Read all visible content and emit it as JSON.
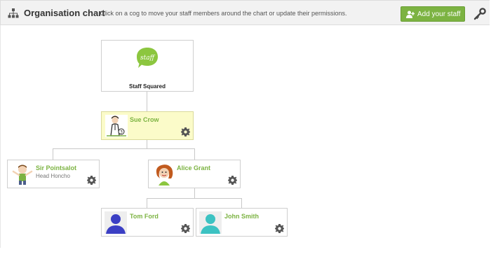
{
  "header": {
    "title": "Organisation chart",
    "subtitle": "- Click on a cog to move your staff members around the chart or update their permissions.",
    "add_button_label": "Add your staff"
  },
  "company": {
    "name": "Staff Squared",
    "logo_text": "staff"
  },
  "staff": [
    {
      "name": "Sue Crow"
    },
    {
      "name": "Sir Pointsalot",
      "role": "Head Honcho"
    },
    {
      "name": "Alice Grant"
    },
    {
      "name": "Tom Ford"
    },
    {
      "name": "John Smith"
    }
  ],
  "colors": {
    "accent": "#7cb342",
    "highlight": "#fbfbc9",
    "tom_avatar": "#3b3fc4",
    "john_avatar": "#3cc2c2"
  }
}
